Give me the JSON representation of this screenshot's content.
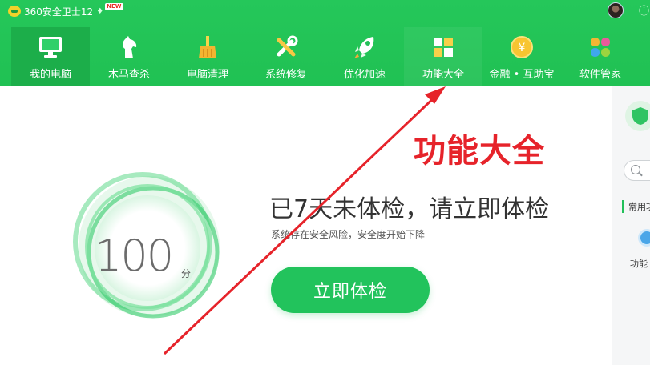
{
  "app": {
    "title": "360安全卫士12",
    "badge": "NEW",
    "gem_icon": "diamond-icon",
    "hint": "ⓘ"
  },
  "nav": {
    "items": [
      {
        "label": "我的电脑",
        "icon": "monitor-icon",
        "active": true
      },
      {
        "label": "木马查杀",
        "icon": "horse-icon"
      },
      {
        "label": "电脑清理",
        "icon": "broom-icon"
      },
      {
        "label": "系统修复",
        "icon": "wrench-icon"
      },
      {
        "label": "优化加速",
        "icon": "rocket-icon"
      },
      {
        "label": "功能大全",
        "icon": "grid-icon"
      },
      {
        "label": "金融 • 互助宝",
        "icon": "yuan-coin-icon"
      },
      {
        "label": "软件管家",
        "icon": "flower-icon"
      }
    ]
  },
  "main": {
    "score": "100",
    "score_unit": "分",
    "headline": "已7天未体检，请立即体检",
    "subtext": "系统存在安全风险，安全度开始下降",
    "cta_label": "立即体检"
  },
  "right_panel": {
    "section_label": "常用功",
    "function_label": "功能"
  },
  "annotation": {
    "text": "功能大全",
    "color": "#e6232a"
  },
  "colors": {
    "brand_green": "#22c35c",
    "nav_active": "#1cae4a"
  }
}
